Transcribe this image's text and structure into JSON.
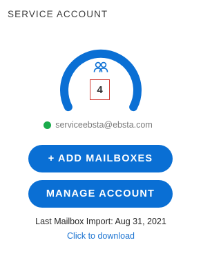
{
  "panel": {
    "title": "SERVICE ACCOUNT"
  },
  "gauge": {
    "icon": "users-icon",
    "count": "4",
    "color": "#0a6fd4"
  },
  "account": {
    "status_color": "#1aab4b",
    "email": "serviceebsta@ebsta.com"
  },
  "buttons": {
    "add_mailboxes": "+ ADD MAILBOXES",
    "manage_account": "MANAGE ACCOUNT"
  },
  "footer": {
    "last_import": "Last Mailbox Import: Aug 31, 2021",
    "download_link": "Click to download"
  }
}
